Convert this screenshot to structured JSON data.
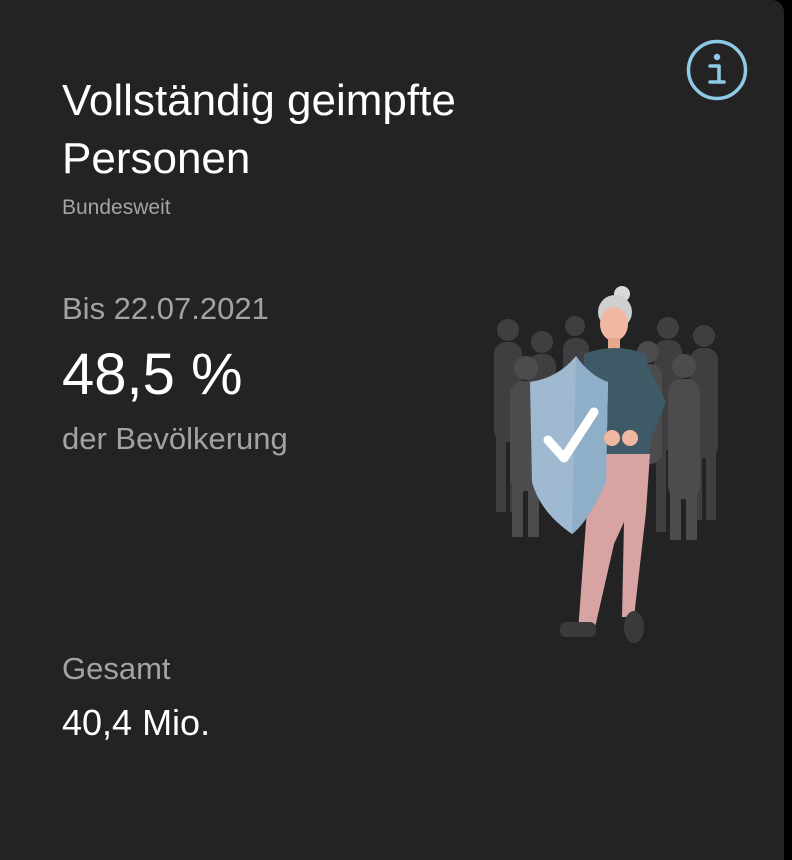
{
  "card": {
    "title": "Vollständig geimpfte Personen",
    "region": "Bundesweit",
    "date_label": "Bis 22.07.2021",
    "percent_value": "48,5 %",
    "percent_caption": "der Bevölkerung",
    "total_label": "Gesamt",
    "total_value": "40,4 Mio.",
    "info_icon": "info-icon",
    "illustration": "vaccinated-person-with-shield-illustration"
  },
  "colors": {
    "background": "#232323",
    "text_primary": "#ffffff",
    "text_secondary": "#a3a3a3",
    "info_accent": "#8ecae6",
    "shield": "#9fbad0",
    "crowd": "#4a4a4c",
    "sweater": "#3e5a66",
    "pants": "#d7a3a3",
    "skin": "#f0b8a0"
  }
}
